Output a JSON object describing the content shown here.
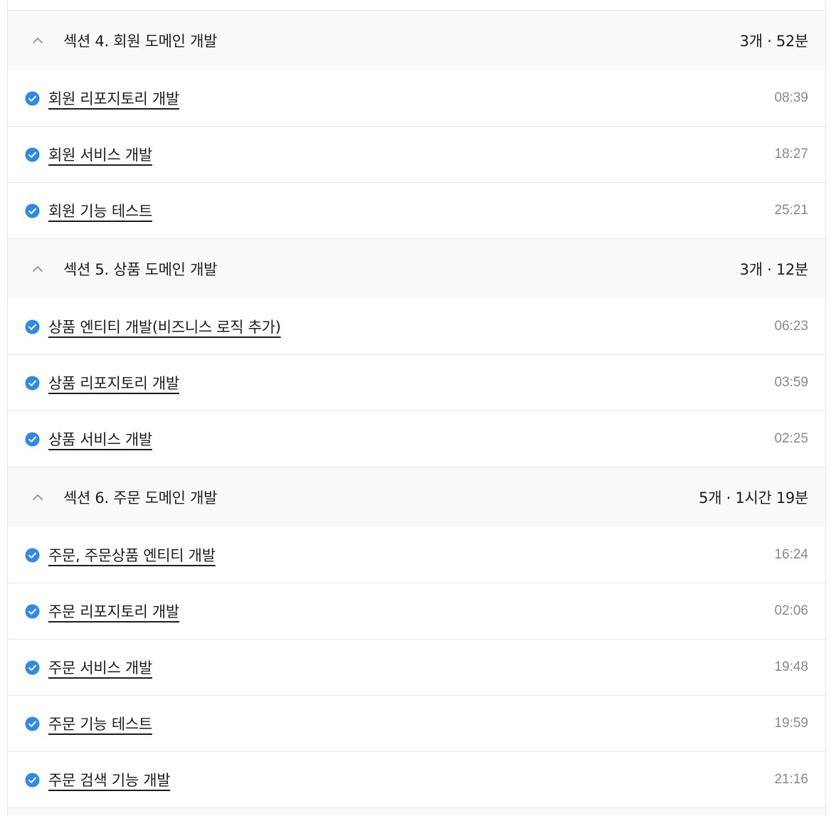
{
  "sections": [
    {
      "title": "섹션 4. 회원 도메인 개발",
      "meta": "3개 · 52분",
      "lectures": [
        {
          "title": "회원 리포지토리 개발",
          "duration": "08:39"
        },
        {
          "title": "회원 서비스 개발",
          "duration": "18:27"
        },
        {
          "title": "회원 기능 테스트",
          "duration": "25:21"
        }
      ]
    },
    {
      "title": "섹션 5. 상품 도메인 개발",
      "meta": "3개 · 12분",
      "lectures": [
        {
          "title": "상품 엔티티 개발(비즈니스 로직 추가)",
          "duration": "06:23"
        },
        {
          "title": "상품 리포지토리 개발",
          "duration": "03:59"
        },
        {
          "title": "상품 서비스 개발",
          "duration": "02:25"
        }
      ]
    },
    {
      "title": "섹션 6. 주문 도메인 개발",
      "meta": "5개 · 1시간 19분",
      "lectures": [
        {
          "title": "주문, 주문상품 엔티티 개발",
          "duration": "16:24"
        },
        {
          "title": "주문 리포지토리 개발",
          "duration": "02:06"
        },
        {
          "title": "주문 서비스 개발",
          "duration": "19:48"
        },
        {
          "title": "주문 기능 테스트",
          "duration": "19:59"
        },
        {
          "title": "주문 검색 기능 개발",
          "duration": "21:16"
        }
      ]
    }
  ],
  "icons": {
    "section_toggle": "chevron-up-icon",
    "lecture_status": "check-circle-icon"
  },
  "colors": {
    "accent": "#2e8ae6",
    "header_bg": "#f8f9fa",
    "divider": "#e4e6ea",
    "text": "#1a1c1f",
    "muted": "#858a8d"
  }
}
